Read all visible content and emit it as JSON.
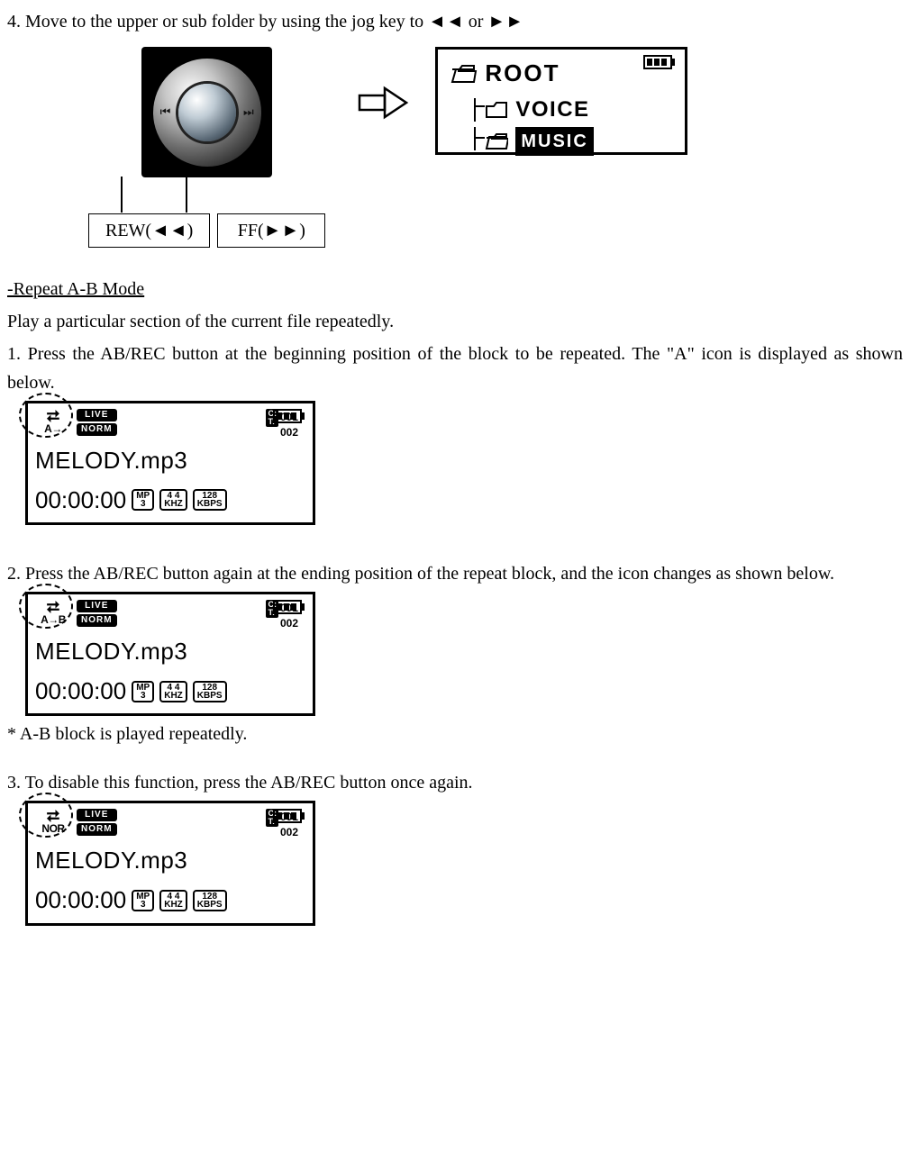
{
  "step4": "4. Move to the upper or sub folder by using the jog key to ◄◄ or ►►",
  "jog": {
    "rew": "REW(◄◄)",
    "ff": "FF(►►)"
  },
  "folderScreen": {
    "root": "ROOT",
    "voice": "VOICE",
    "music": "MUSIC"
  },
  "section": {
    "title": "-Repeat A-B Mode",
    "intro": "Play a particular section of the current file repeatedly."
  },
  "step1": "1. Press the AB/REC button at the beginning position of the block to be repeated. The \"A\" icon is displayed as shown below.",
  "step2": "2. Press the AB/REC button again at the ending position of the repeat block, and the icon changes as shown below.",
  "footnote": "* A-B block is played repeatedly.",
  "step3": "3. To disable this function, press the AB/REC button once again.",
  "lcd": {
    "live": "LIVE",
    "norm": "NORM",
    "c": "001",
    "t": "002",
    "filename": "MELODY.mp3",
    "time": "00:00:00",
    "box1": {
      "l1": "MP",
      "l2": "3"
    },
    "box2": {
      "l1": "4 4",
      "l2": "KHZ"
    },
    "box3": {
      "l1": "128",
      "l2": "KBPS"
    }
  },
  "repeat": {
    "a": "A→",
    "ab": "A→B",
    "nor": "NOR"
  }
}
